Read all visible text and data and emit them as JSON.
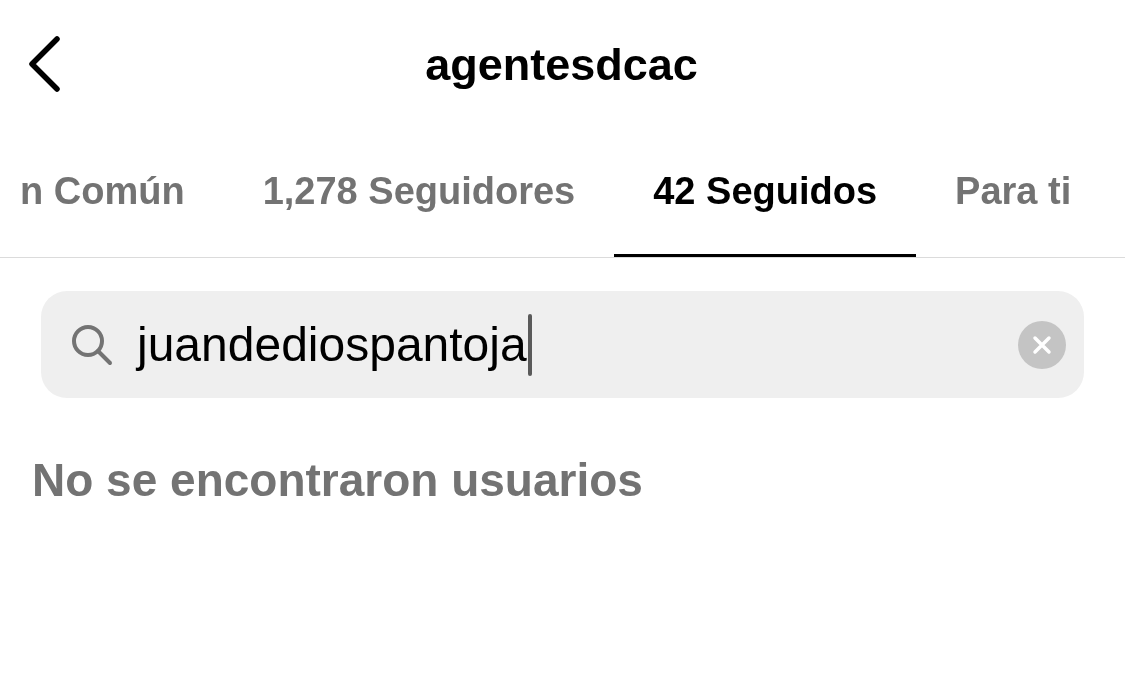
{
  "header": {
    "title": "agentesdcac"
  },
  "tabs": [
    {
      "label": "n Común",
      "selected": false
    },
    {
      "label": "1,278 Seguidores",
      "selected": false
    },
    {
      "label": "42 Seguidos",
      "selected": true
    },
    {
      "label": "Para ti",
      "selected": false
    }
  ],
  "search": {
    "value": "juandediospantoja",
    "focused": true
  },
  "empty_message": "No se encontraron usuarios"
}
